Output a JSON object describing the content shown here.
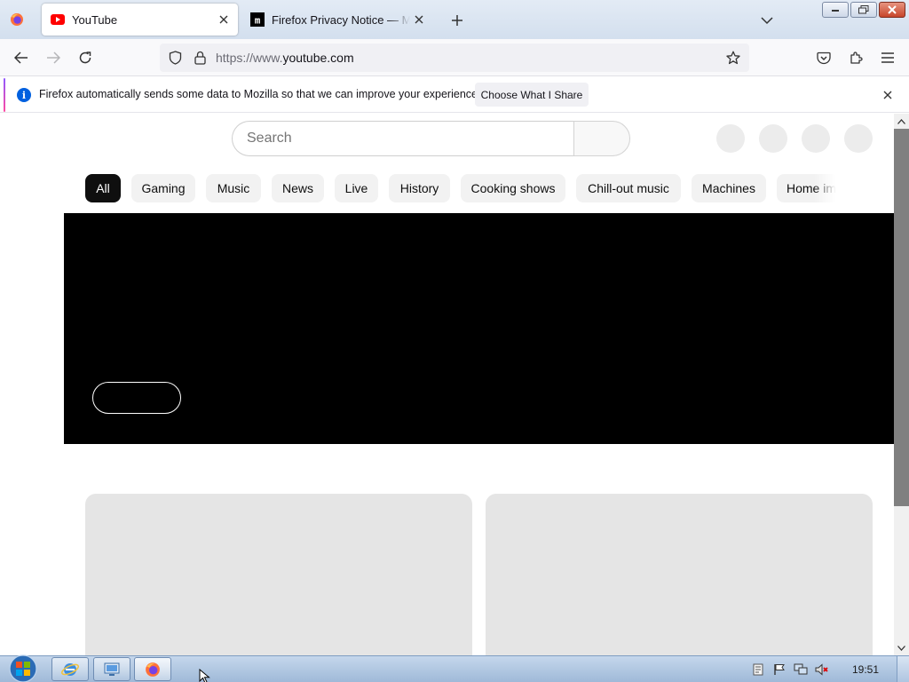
{
  "tabs": [
    {
      "title": "YouTube",
      "favicon": "youtube-icon",
      "active": true
    },
    {
      "title": "Firefox Privacy Notice — Mozilla",
      "favicon": "mozilla-icon",
      "active": false
    }
  ],
  "navbar": {
    "url_prefix": "https://www.",
    "url_domain": "youtube.com"
  },
  "notification": {
    "message": "Firefox automatically sends some data to Mozilla so that we can improve your experience.",
    "button_label": "Choose What I Share"
  },
  "page": {
    "search_placeholder": "Search",
    "chips": [
      "All",
      "Gaming",
      "Music",
      "News",
      "Live",
      "History",
      "Cooking shows",
      "Chill-out music",
      "Machines",
      "Home improvement"
    ],
    "selected_chip": "All"
  },
  "taskbar": {
    "clock": "19:51",
    "pinned": [
      "internet-explorer-icon",
      "network-app-icon",
      "firefox-icon"
    ]
  },
  "colors": {
    "youtube_red": "#ff0000",
    "firefox_blue": "#0060df",
    "hero_bg": "#000000",
    "chip_bg": "#f2f2f2",
    "chip_selected_bg": "#0f0f0f"
  }
}
